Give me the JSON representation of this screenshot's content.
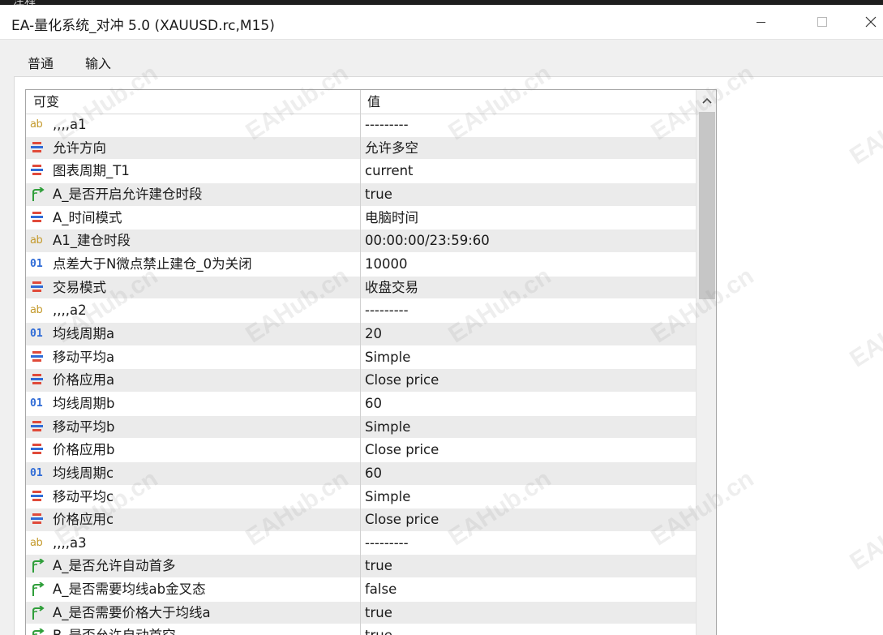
{
  "top_strip": {
    "text": "注释"
  },
  "window": {
    "title": "EA-量化系统_对冲 5.0 (XAUUSD.rc,M15)",
    "minimize_icon": "minimize-icon",
    "maximize_icon": "maximize-icon",
    "close_icon": "close-icon"
  },
  "tabs": [
    {
      "label": "普通",
      "active": false
    },
    {
      "label": "输入",
      "active": true
    }
  ],
  "colors": {
    "active_tab_underline": "#0078d7",
    "row_alt": "#ebebeb",
    "string_icon": "#c49a2c",
    "enum_icon_red": "#e04a3a",
    "enum_icon_blue": "#2f6bd6",
    "bool_icon": "#2f9e3a",
    "int_icon": "#2f6bd6"
  },
  "table": {
    "headers": {
      "name": "可变",
      "value": "值"
    },
    "rows": [
      {
        "icon": "string",
        "name": ",,,,a1",
        "value": "---------"
      },
      {
        "icon": "enum",
        "name": "允许方向",
        "value": "允许多空"
      },
      {
        "icon": "enum",
        "name": "图表周期_T1",
        "value": "current"
      },
      {
        "icon": "bool",
        "name": "A_是否开启允许建仓时段",
        "value": "true"
      },
      {
        "icon": "enum",
        "name": "A_时间模式",
        "value": "电脑时间"
      },
      {
        "icon": "string",
        "name": "A1_建仓时段",
        "value": "00:00:00/23:59:60"
      },
      {
        "icon": "int",
        "name": "点差大于N微点禁止建仓_0为关闭",
        "value": "10000"
      },
      {
        "icon": "enum",
        "name": "交易模式",
        "value": "收盘交易"
      },
      {
        "icon": "string",
        "name": ",,,,a2",
        "value": "---------"
      },
      {
        "icon": "int",
        "name": "均线周期a",
        "value": "20"
      },
      {
        "icon": "enum",
        "name": "移动平均a",
        "value": "Simple"
      },
      {
        "icon": "enum",
        "name": "价格应用a",
        "value": "Close price"
      },
      {
        "icon": "int",
        "name": "均线周期b",
        "value": "60"
      },
      {
        "icon": "enum",
        "name": "移动平均b",
        "value": "Simple"
      },
      {
        "icon": "enum",
        "name": "价格应用b",
        "value": "Close price"
      },
      {
        "icon": "int",
        "name": "均线周期c",
        "value": "60"
      },
      {
        "icon": "enum",
        "name": "移动平均c",
        "value": "Simple"
      },
      {
        "icon": "enum",
        "name": "价格应用c",
        "value": "Close price"
      },
      {
        "icon": "string",
        "name": ",,,,a3",
        "value": "---------"
      },
      {
        "icon": "bool",
        "name": "A_是否允许自动首多",
        "value": "true"
      },
      {
        "icon": "bool",
        "name": "A_是否需要均线ab金叉态",
        "value": "false"
      },
      {
        "icon": "bool",
        "name": "A_是否需要价格大于均线a",
        "value": "true"
      },
      {
        "icon": "bool",
        "name": "B_是否允许自动首空",
        "value": "true"
      }
    ]
  },
  "scrollbar": {
    "up_icon": "scroll-up-chevron-icon"
  },
  "watermarks": [
    {
      "text": "EAHub.cn"
    }
  ]
}
